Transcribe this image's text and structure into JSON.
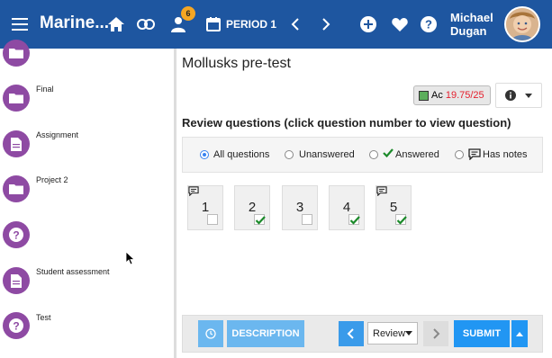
{
  "header": {
    "title": "Marine...",
    "notification_count": "6",
    "period": "PERIOD 1",
    "user_first": "Michael",
    "user_last": "Dugan",
    "accent": "#1e56a0"
  },
  "sidebar": {
    "items": [
      {
        "label": "",
        "icon": "folder-icon"
      },
      {
        "label": "Final",
        "icon": "folder-icon"
      },
      {
        "label": "Assignment",
        "icon": "document-icon"
      },
      {
        "label": "Project 2",
        "icon": "folder-icon"
      },
      {
        "label": "",
        "icon": "question-icon"
      },
      {
        "label": "Student assessment",
        "icon": "document-icon"
      },
      {
        "label": "Test",
        "icon": "question-icon"
      }
    ],
    "icon_color": "#8e4aa3"
  },
  "main": {
    "title": "Mollusks pre-test",
    "score_prefix": "Ac",
    "score": "19.75/25",
    "review_heading": "Review questions (click question number to view question)",
    "filters": [
      {
        "label": "All questions",
        "checked": true
      },
      {
        "label": "Unanswered",
        "checked": false
      },
      {
        "label": "Answered",
        "checked": false
      },
      {
        "label": "Has notes",
        "checked": false
      }
    ],
    "questions": [
      {
        "number": "1",
        "has_note": true,
        "answered": false
      },
      {
        "number": "2",
        "has_note": false,
        "answered": true
      },
      {
        "number": "3",
        "has_note": false,
        "answered": false
      },
      {
        "number": "4",
        "has_note": false,
        "answered": true
      },
      {
        "number": "5",
        "has_note": true,
        "answered": true
      }
    ]
  },
  "footer": {
    "description_label": "DESCRIPTION",
    "review_select": "Review",
    "submit_label": "SUBMIT"
  }
}
